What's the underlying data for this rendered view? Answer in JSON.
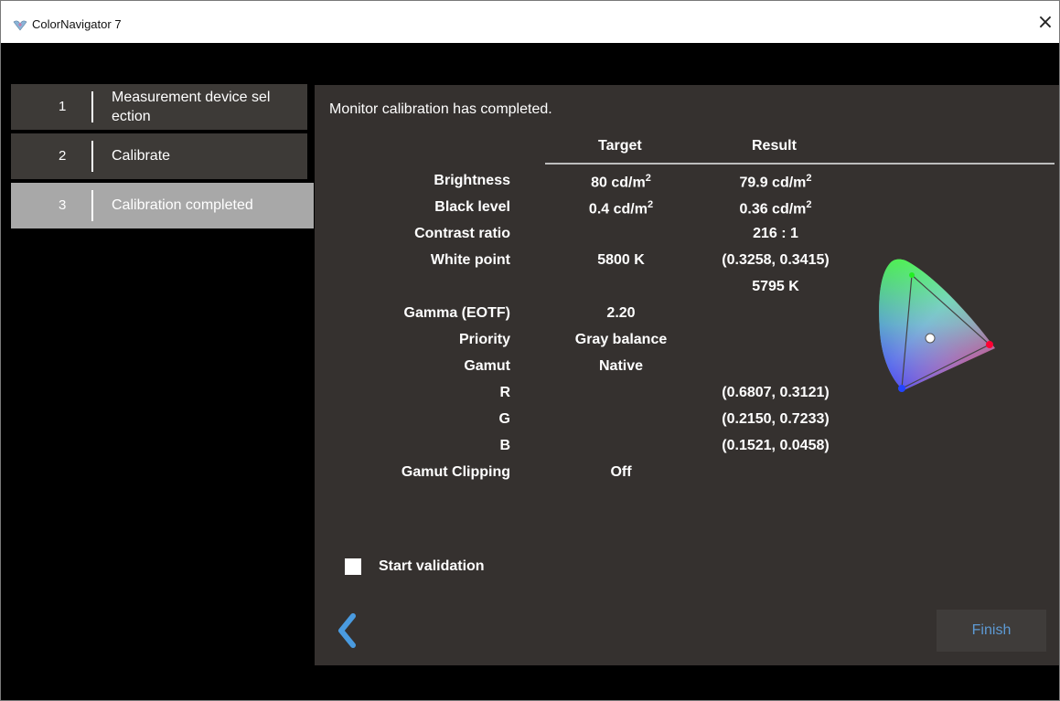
{
  "window": {
    "title": "ColorNavigator 7",
    "close_glyph": "×"
  },
  "steps": [
    {
      "num": "1",
      "label_line1": "Measurement device sel",
      "label_line2": "ection"
    },
    {
      "num": "2",
      "label": "Calibrate"
    },
    {
      "num": "3",
      "label": "Calibration completed"
    }
  ],
  "main": {
    "headline": "Monitor calibration has completed.",
    "headers": {
      "target": "Target",
      "result": "Result"
    },
    "rows": {
      "brightness": {
        "label": "Brightness",
        "target": "80 cd/m",
        "result": "79.9 cd/m",
        "unit_sup": "2"
      },
      "black_level": {
        "label": "Black level",
        "target": "0.4 cd/m",
        "result": "0.36 cd/m",
        "unit_sup": "2"
      },
      "contrast": {
        "label": "Contrast ratio",
        "result": "216 : 1"
      },
      "white_point": {
        "label": "White point",
        "target": "5800 K",
        "result": "(0.3258, 0.3415)",
        "result2": "5795 K"
      },
      "gamma": {
        "label": "Gamma (EOTF)",
        "target": "2.20"
      },
      "priority": {
        "label": "Priority",
        "target": "Gray balance"
      },
      "gamut": {
        "label": "Gamut",
        "target": "Native"
      },
      "r": {
        "label": "R",
        "result": "(0.6807, 0.3121)"
      },
      "g": {
        "label": "G",
        "result": "(0.2150, 0.7233)"
      },
      "b": {
        "label": "B",
        "result": "(0.1521, 0.0458)"
      },
      "gamut_clipping": {
        "label": "Gamut Clipping",
        "target": "Off"
      }
    },
    "start_validation": {
      "label": "Start validation",
      "checked": false
    },
    "finish_label": "Finish"
  },
  "colors": {
    "panel_bg": "#35312f",
    "step_bg": "#3d3a37",
    "active_step_bg": "#a8a8a8",
    "accent": "#5d9ad4"
  }
}
